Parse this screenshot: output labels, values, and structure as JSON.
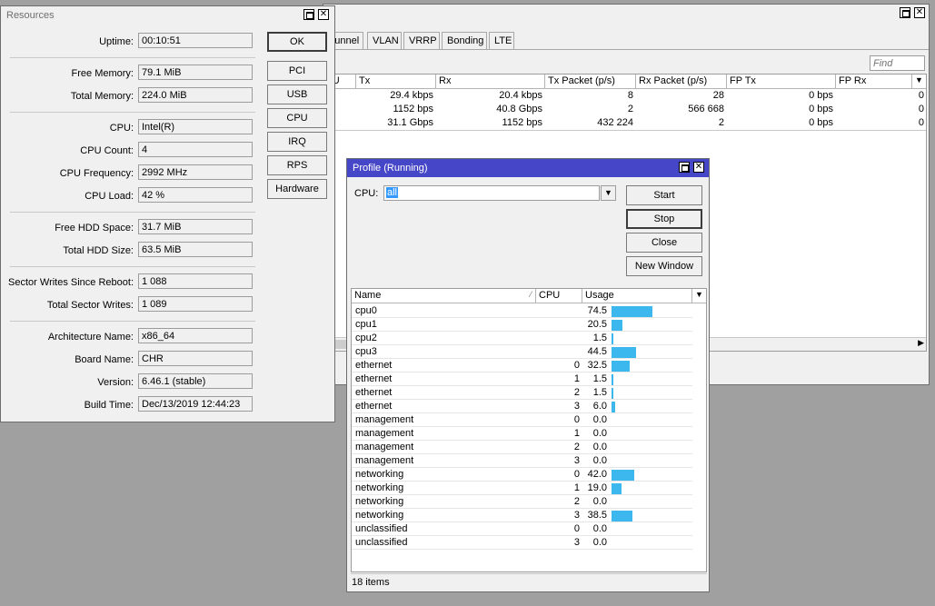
{
  "interfaces_window": {
    "tabs": [
      "Tunnel",
      "VLAN",
      "VRRP",
      "Bonding",
      "LTE"
    ],
    "find_placeholder": "Find",
    "columns": [
      "TU",
      "Tx",
      "Rx",
      "Tx Packet (p/s)",
      "Rx Packet (p/s)",
      "FP Tx",
      "FP Rx"
    ],
    "rows": [
      {
        "tx": "29.4 kbps",
        "rx": "20.4 kbps",
        "txp": "8",
        "rxp": "28",
        "fptx": "0 bps",
        "fprx": "0"
      },
      {
        "tx": "1152 bps",
        "rx": "40.8 Gbps",
        "txp": "2",
        "rxp": "566 668",
        "fptx": "0 bps",
        "fprx": "0"
      },
      {
        "tx": "31.1 Gbps",
        "rx": "1152 bps",
        "txp": "432 224",
        "rxp": "2",
        "fptx": "0 bps",
        "fprx": "0"
      }
    ]
  },
  "resources": {
    "title": "Resources",
    "fields": [
      {
        "label": "Uptime:",
        "value": "00:10:51"
      },
      {
        "label": "Free Memory:",
        "value": "79.1 MiB"
      },
      {
        "label": "Total Memory:",
        "value": "224.0 MiB"
      },
      {
        "label": "CPU:",
        "value": "Intel(R)"
      },
      {
        "label": "CPU Count:",
        "value": "4"
      },
      {
        "label": "CPU Frequency:",
        "value": "2992 MHz"
      },
      {
        "label": "CPU Load:",
        "value": "42 %"
      },
      {
        "label": "Free HDD Space:",
        "value": "31.7 MiB"
      },
      {
        "label": "Total HDD Size:",
        "value": "63.5 MiB"
      },
      {
        "label": "Sector Writes Since Reboot:",
        "value": "1 088"
      },
      {
        "label": "Total Sector Writes:",
        "value": "1 089"
      },
      {
        "label": "Architecture Name:",
        "value": "x86_64"
      },
      {
        "label": "Board Name:",
        "value": "CHR"
      },
      {
        "label": "Version:",
        "value": "6.46.1 (stable)"
      },
      {
        "label": "Build Time:",
        "value": "Dec/13/2019 12:44:23"
      }
    ],
    "buttons": [
      "OK",
      "PCI",
      "USB",
      "CPU",
      "IRQ",
      "RPS",
      "Hardware"
    ]
  },
  "profile": {
    "title": "Profile (Running)",
    "cpu_label": "CPU:",
    "cpu_value": "all",
    "buttons": [
      "Start",
      "Stop",
      "Close",
      "New Window"
    ],
    "columns": [
      "Name",
      "CPU",
      "Usage"
    ],
    "rows": [
      {
        "name": "cpu0",
        "cpu": "",
        "usage": "74.5",
        "level": 74.5
      },
      {
        "name": "cpu1",
        "cpu": "",
        "usage": "20.5",
        "level": 20.5
      },
      {
        "name": "cpu2",
        "cpu": "",
        "usage": "1.5",
        "level": 1.5
      },
      {
        "name": "cpu3",
        "cpu": "",
        "usage": "44.5",
        "level": 44.5
      },
      {
        "name": "ethernet",
        "cpu": "0",
        "usage": "32.5",
        "level": 32.5
      },
      {
        "name": "ethernet",
        "cpu": "1",
        "usage": "1.5",
        "level": 1.5
      },
      {
        "name": "ethernet",
        "cpu": "2",
        "usage": "1.5",
        "level": 1.5
      },
      {
        "name": "ethernet",
        "cpu": "3",
        "usage": "6.0",
        "level": 6.0
      },
      {
        "name": "management",
        "cpu": "0",
        "usage": "0.0",
        "level": 0
      },
      {
        "name": "management",
        "cpu": "1",
        "usage": "0.0",
        "level": 0
      },
      {
        "name": "management",
        "cpu": "2",
        "usage": "0.0",
        "level": 0
      },
      {
        "name": "management",
        "cpu": "3",
        "usage": "0.0",
        "level": 0
      },
      {
        "name": "networking",
        "cpu": "0",
        "usage": "42.0",
        "level": 42.0
      },
      {
        "name": "networking",
        "cpu": "1",
        "usage": "19.0",
        "level": 19.0
      },
      {
        "name": "networking",
        "cpu": "2",
        "usage": "0.0",
        "level": 0
      },
      {
        "name": "networking",
        "cpu": "3",
        "usage": "38.5",
        "level": 38.5
      },
      {
        "name": "unclassified",
        "cpu": "0",
        "usage": "0.0",
        "level": 0
      },
      {
        "name": "unclassified",
        "cpu": "3",
        "usage": "0.0",
        "level": 0
      }
    ],
    "status": "18 items"
  },
  "colors": {
    "usage_bar": "#3db8ef",
    "active_title": "#4646c8"
  }
}
